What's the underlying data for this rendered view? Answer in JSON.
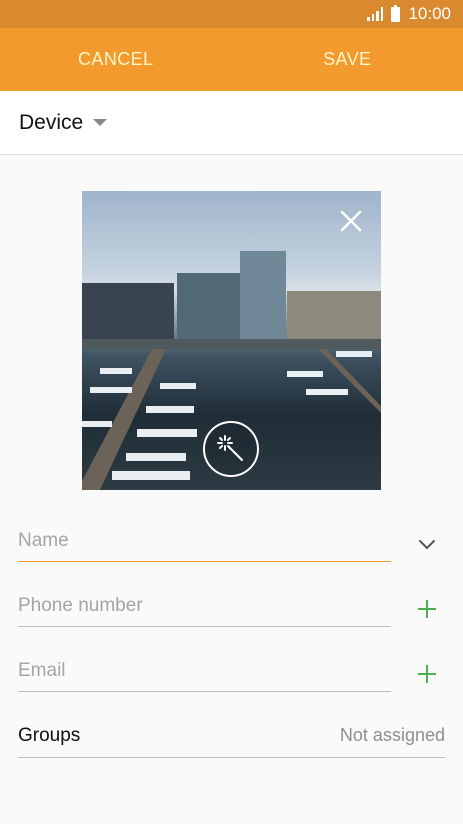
{
  "status_bar": {
    "time": "10:00"
  },
  "action_bar": {
    "cancel_label": "CANCEL",
    "save_label": "SAVE"
  },
  "storage": {
    "selected": "Device"
  },
  "fields": {
    "name_placeholder": "Name",
    "phone_placeholder": "Phone number",
    "email_placeholder": "Email"
  },
  "groups": {
    "label": "Groups",
    "value": "Not assigned"
  },
  "icons": [
    "signal-icon",
    "battery-icon",
    "caret-down-icon",
    "close-icon",
    "magic-wand-icon",
    "chevron-down-icon",
    "plus-icon"
  ],
  "colors": {
    "accent": "#f39a2f",
    "status_bar": "#d98a2e",
    "plus": "#4caf50"
  }
}
